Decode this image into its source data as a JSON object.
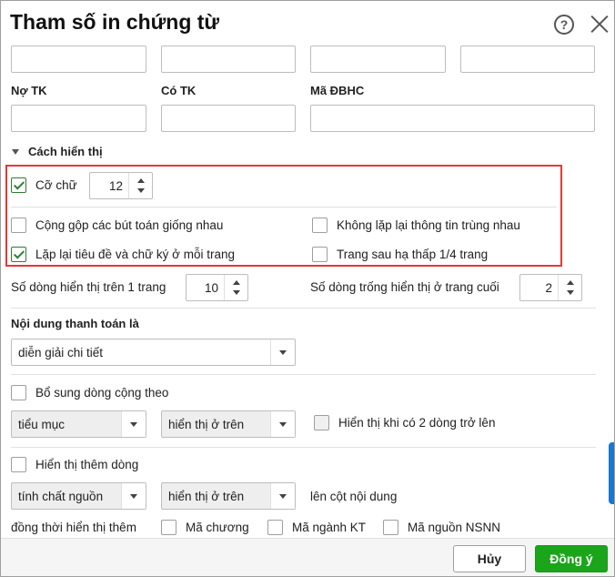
{
  "dialog": {
    "title": "Tham số in chứng từ",
    "help_glyph": "?"
  },
  "fields": {
    "no_tk_label": "Nợ TK",
    "co_tk_label": "Có TK",
    "ma_dbhc_label": "Mã ĐBHC"
  },
  "display": {
    "section_label": "Cách hiển thị",
    "font_size_label": "Cỡ chữ",
    "font_size_value": "12",
    "merge_entries_label": "Cộng gộp các bút toán giống nhau",
    "no_repeat_label": "Không lặp lại thông tin trùng nhau",
    "repeat_header_label": "Lặp lại tiêu đề và chữ ký ở mỗi trang",
    "lower_next_page_label": "Trang sau hạ thấp 1/4 trang",
    "rows_per_page_label": "Số dòng hiển thị trên 1 trang",
    "rows_per_page_value": "10",
    "blank_rows_label": "Số dòng trống hiển thị ở trang cuối",
    "blank_rows_value": "2"
  },
  "payment": {
    "label": "Nội dung thanh toán là",
    "selected": "diễn giải chi tiết"
  },
  "sum_rows": {
    "label": "Bổ sung dòng cộng theo",
    "group_by": "tiểu mục",
    "position": "hiển thị ở trên",
    "show_when_label": "Hiển thị khi có 2 dòng trở lên"
  },
  "extra_rows": {
    "label": "Hiển thị thêm dòng",
    "source": "tính chất nguồn",
    "position": "hiển thị ở trên",
    "suffix": "lên cột nội dung",
    "also_show_label": "đồng thời hiển thị thêm",
    "ma_chuong": "Mã chương",
    "ma_nganh_kt": "Mã ngành KT",
    "ma_nguon_nsnn": "Mã nguồn NSNN"
  },
  "footer": {
    "cancel": "Hủy",
    "ok": "Đồng ý"
  },
  "colors": {
    "ok_button": "#1aa51a",
    "highlight_box": "#e53935",
    "check": "#2e7d32"
  }
}
